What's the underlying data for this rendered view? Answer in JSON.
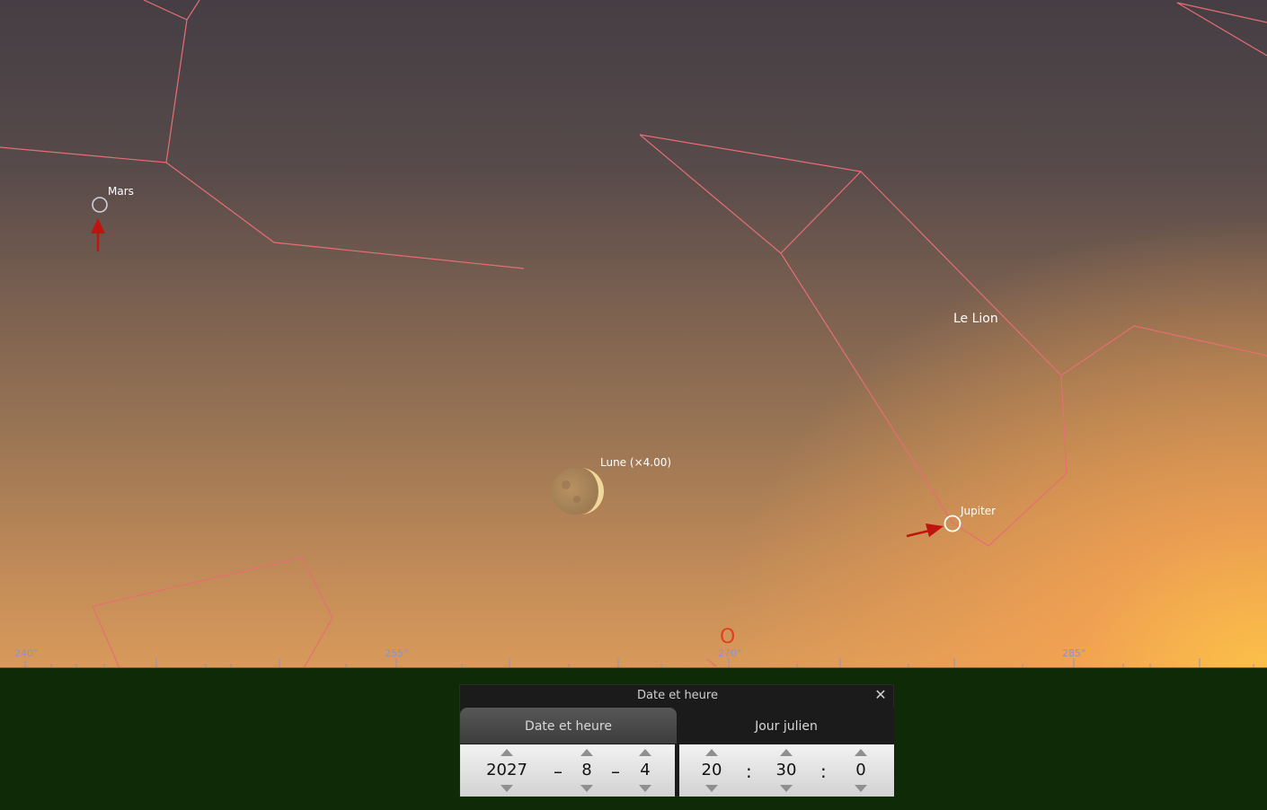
{
  "sky": {
    "constellation_label": "Le Lion",
    "objects": {
      "mars": "Mars",
      "moon": "Lune (×4.00)",
      "jupiter": "Jupiter"
    },
    "azimuth_labels": [
      "240°",
      "255°",
      "270°",
      "285°"
    ],
    "cardinal": "O",
    "colors": {
      "constellation_lines": "#e66e74",
      "horizon": "#d2412a",
      "ground": "#0f2a07",
      "pointer_arrow": "#c0140e"
    }
  },
  "dialog": {
    "title": "Date et heure",
    "close_icon": "close-icon",
    "tabs": [
      {
        "label": "Date et heure",
        "active": true
      },
      {
        "label": "Jour julien",
        "active": false
      }
    ],
    "date": {
      "year": "2027",
      "month": "8",
      "day": "4",
      "sep": "–"
    },
    "time": {
      "hour": "20",
      "minute": "30",
      "second": "0",
      "sep": ":"
    }
  }
}
